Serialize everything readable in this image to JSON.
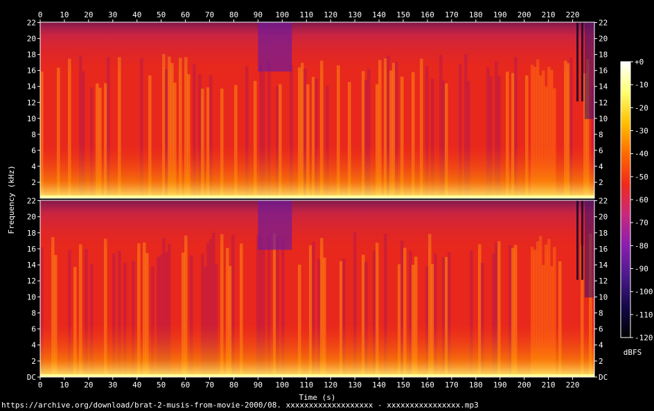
{
  "chart_data": {
    "type": "heatmap",
    "xlabel": "Time (s)",
    "ylabel": "Frequency (kHz)",
    "x_ticks": [
      0,
      10,
      20,
      30,
      40,
      50,
      60,
      70,
      80,
      90,
      100,
      110,
      120,
      130,
      140,
      150,
      160,
      170,
      180,
      190,
      200,
      210,
      220
    ],
    "x_range": [
      0,
      229
    ],
    "channels": [
      {
        "y_ticks": [
          "2",
          "4",
          "6",
          "8",
          "10",
          "12",
          "14",
          "16",
          "18",
          "20",
          "22"
        ]
      },
      {
        "y_ticks": [
          "DC",
          "2",
          "4",
          "6",
          "8",
          "10",
          "12",
          "14",
          "16",
          "18",
          "20",
          "22"
        ]
      }
    ],
    "y_range_khz": [
      0,
      22.05
    ],
    "colorbar": {
      "label": "dBFS",
      "ticks": [
        "+0",
        "-10",
        "-20",
        "-30",
        "-40",
        "-50",
        "-60",
        "-70",
        "-80",
        "-90",
        "-100",
        "-110",
        "-120"
      ],
      "range": [
        -120,
        0
      ],
      "colors": [
        "#000000",
        "#140848",
        "#4a1a8a",
        "#8a1eb0",
        "#c8287e",
        "#f02a1a",
        "#ff6a00",
        "#ffc000",
        "#ffff70",
        "#ffffff"
      ]
    },
    "annotations": {
      "quiet_high_band_interval_s": [
        90,
        104
      ],
      "bright_band_interval_s": [
        202,
        212
      ],
      "silence_dropout_times_s": [
        222,
        224
      ]
    }
  },
  "caption": "https://archive.org/download/brat-2-musis-from-movie-2000/08. xxxxxxxxxxxxxxxxxxx - xxxxxxxxxxxxxxxx.mp3"
}
